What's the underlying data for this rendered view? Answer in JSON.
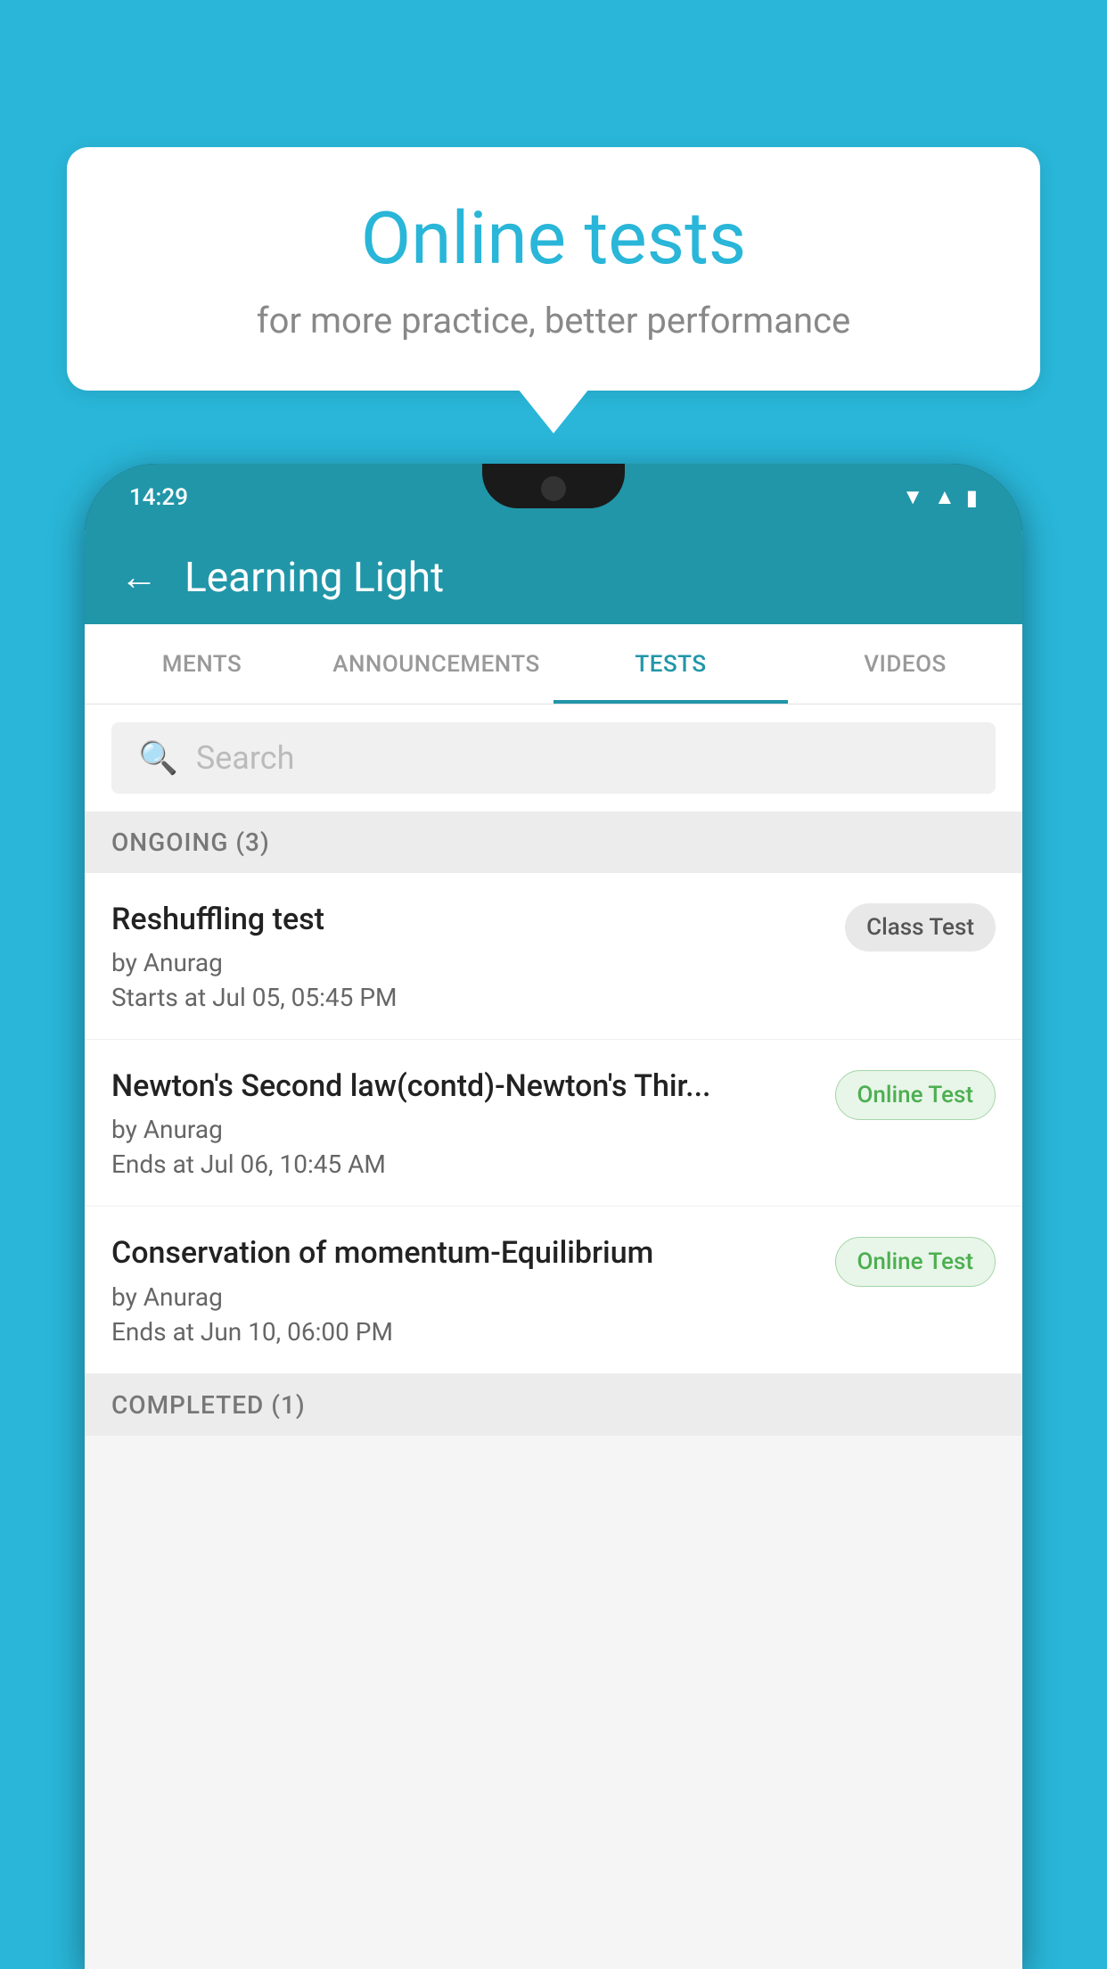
{
  "background_color": "#29b6d8",
  "bubble": {
    "title": "Online tests",
    "subtitle": "for more practice, better performance"
  },
  "phone": {
    "status_bar": {
      "time": "14:29"
    },
    "header": {
      "title": "Learning Light",
      "back_label": "←"
    },
    "tabs": [
      {
        "label": "MENTS",
        "active": false
      },
      {
        "label": "ANNOUNCEMENTS",
        "active": false
      },
      {
        "label": "TESTS",
        "active": true
      },
      {
        "label": "VIDEOS",
        "active": false
      }
    ],
    "search": {
      "placeholder": "Search"
    },
    "ongoing_section": {
      "label": "ONGOING (3)"
    },
    "tests": [
      {
        "title": "Reshuffling test",
        "author": "by Anurag",
        "date": "Starts at  Jul 05, 05:45 PM",
        "badge": "Class Test",
        "badge_type": "class"
      },
      {
        "title": "Newton's Second law(contd)-Newton's Thir...",
        "author": "by Anurag",
        "date": "Ends at  Jul 06, 10:45 AM",
        "badge": "Online Test",
        "badge_type": "online"
      },
      {
        "title": "Conservation of momentum-Equilibrium",
        "author": "by Anurag",
        "date": "Ends at  Jun 10, 06:00 PM",
        "badge": "Online Test",
        "badge_type": "online"
      }
    ],
    "completed_section": {
      "label": "COMPLETED (1)"
    }
  }
}
